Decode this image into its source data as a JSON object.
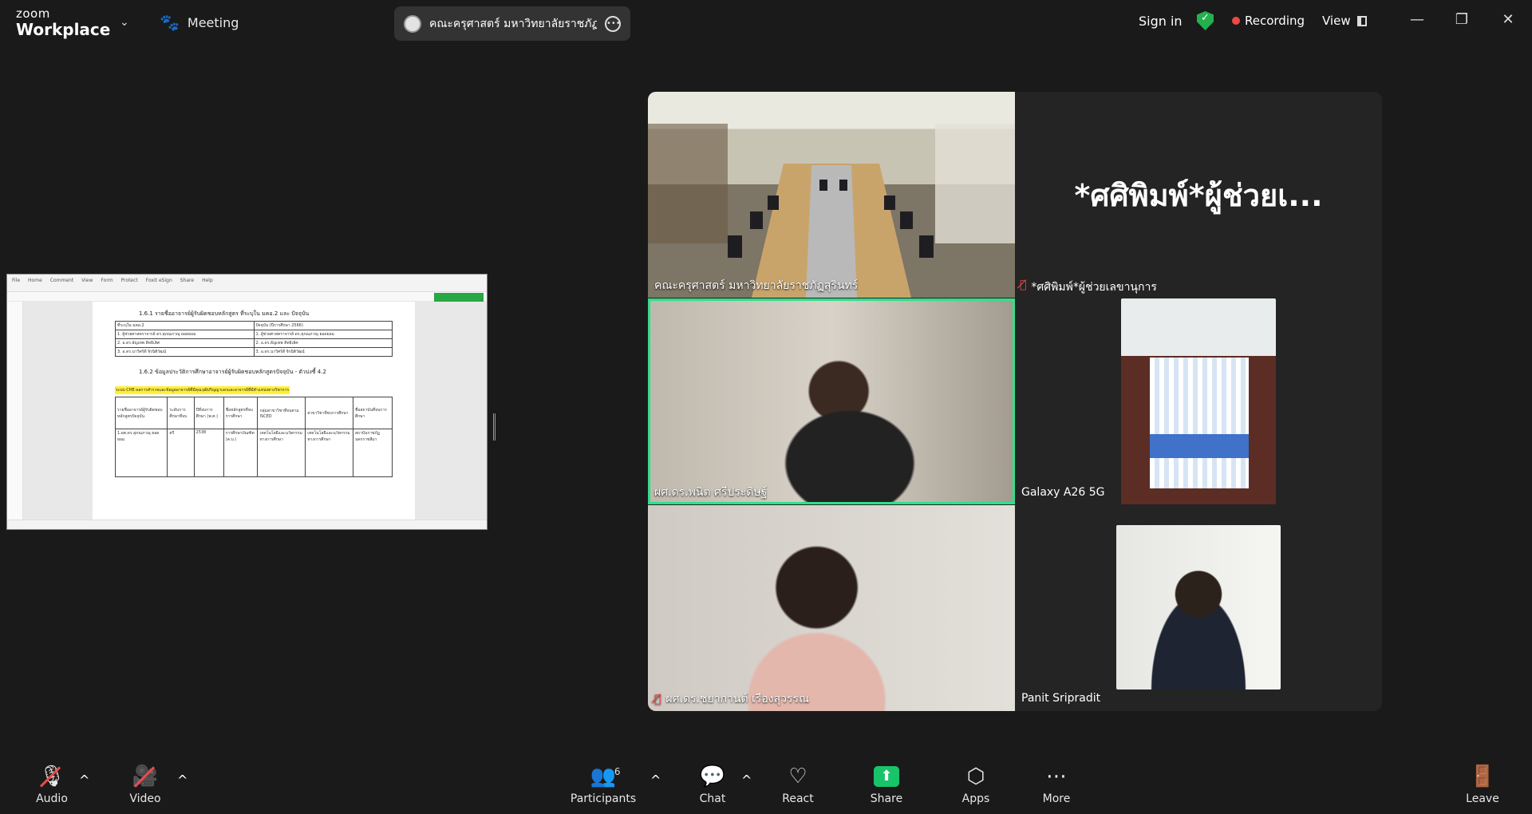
{
  "header": {
    "logo_top": "zoom",
    "logo_bottom": "Workplace",
    "meeting_label": "Meeting",
    "meeting_title": "คณะครุศาสตร์ มหาวิทยาลัยราชภัฏสุริน",
    "sign_in": "Sign in",
    "recording": "Recording",
    "view": "View"
  },
  "share": {
    "ribbon": [
      "File",
      "Home",
      "Comment",
      "View",
      "Form",
      "Protect",
      "Foxit eSign",
      "Share",
      "Help"
    ],
    "heading1": "1.6.1 รายชื่ออาจารย์ผู้รับผิดชอบหลักสูตร ที่ระบุใน มคอ.2 และ ปัจจุบัน",
    "col_left": "ที่ระบุใน มคอ.2",
    "col_right": "ปัจจุบัน (ปีการศึกษา 2566)",
    "rows": [
      [
        "1. ผู้ช่วยศาสตราจารย์ ดร.สุภณภาณุ ยอดยอม",
        "1. ผู้ช่วยศาสตราจารย์ ดร.สุภณภาณุ ยอดยอม"
      ],
      [
        "2. อ.ดร.ธัญเทพ สิทธิเลิศ",
        "2. อ.ดร.ธัญเทพ สิทธิเลิศ"
      ],
      [
        "3. อ.ดร.นาวิศร์ดี จิรนิติวัฒน์",
        "3. อ.ดร.นาวิศร์ดี จิรนิติวัฒน์"
      ]
    ],
    "heading2": "1.6.2 ข้อมูลประวัติการศึกษาอาจารย์ผู้รับผิดชอบหลักสูตรปัจจุบัน - ตัวบ่งชี้ 4.2",
    "highlight": "ระบบ CHE ผลการสำรวจและข้อมูลอาจารย์ที่มีคุณวุฒิปริญญาเอกและอาจารย์ที่มีตำแหน่งทางวิชาการ",
    "grid_head": [
      "รายชื่ออาจารย์ผู้รับผิดชอบหลักสูตรปัจจุบัน",
      "ระดับการศึกษาที่จบ",
      "ปีที่จบการศึกษา (พ.ศ.)",
      "ชื่อหลักสูตรที่จบการศึกษา",
      "กลุ่มสาขาวิชาที่จบตาม ISCED",
      "สาขาวิชาที่จบการศึกษา",
      "ชื่อสถาบันที่จบการศึกษา"
    ],
    "grid_row": [
      "1.ผศ.ดร.สุภณภาณุ ยอดยอม",
      "ตรี",
      "2538",
      "การศึกษาบัณฑิต (ค.บ.)",
      "เทคโนโลยีและนวัตกรรมทางการศึกษา",
      "เทคโนโลยีและนวัตกรรมทางการศึกษา",
      "สถาบันราชภัฏนครราชสีมา"
    ]
  },
  "gallery": {
    "tile1_name": "คณะครุศาสตร์ มหาวิทยาลัยราชภัฏสุรินทร์",
    "tile2_big": "*ศศิพิมพ์*ผู้ช่วยเ...",
    "tile2_name": "*ศศิพิมพ์*ผู้ช่วยเลขานุการ",
    "tile3_name": "ผศ.ดร.พนิต ศรีประดิษฐ์",
    "tile4_name": "Galaxy A26 5G",
    "tile5_name": "ผศ.ดร.ชยากานต์ เรืองสุวรรณ",
    "tile6_name": "Panit Sripradit"
  },
  "toolbar": {
    "audio": "Audio",
    "video": "Video",
    "participants": "Participants",
    "participants_count": "6",
    "chat": "Chat",
    "react": "React",
    "share": "Share",
    "apps": "Apps",
    "more": "More",
    "leave": "Leave"
  },
  "colors": {
    "accent_green": "#18c46a",
    "speaker_border": "#2ee08a",
    "mute_red": "#f04848"
  }
}
